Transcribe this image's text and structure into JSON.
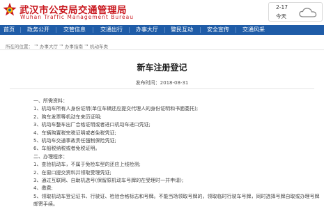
{
  "header": {
    "site_name": "武汉市公安局交通管理局",
    "site_name_en": "Wuhan Traffic Management Bureau",
    "brand_color": "#c8161d",
    "weather": {
      "date": "2-17",
      "today": "今天",
      "icon": "cloud-icon"
    }
  },
  "nav": {
    "background": "#1f5ca7",
    "items": [
      {
        "label": "首页"
      },
      {
        "label": "政务公开"
      },
      {
        "label": "交管信息"
      },
      {
        "label": "交通出行"
      },
      {
        "label": "办事大厅"
      },
      {
        "label": "警民互动"
      },
      {
        "label": "安全宣传"
      },
      {
        "label": "交通风采"
      }
    ]
  },
  "breadcrumb": {
    "prefix": "所在的位置：",
    "items": [
      "办事大厅",
      "办事指南",
      "机动车类"
    ],
    "separator": "→"
  },
  "article": {
    "title": "新车注册登记",
    "meta": "发布时间：2018-08-31",
    "lines": [
      "一、所需资料：",
      "1、机动车所有人身份证明(单位车辆还应提交代理人的身份证明和书面委托);",
      "2、购车发票等机动车来历证明;",
      "3、机动车整车出厂合格证明或者进口机动车进口凭证;",
      "4、车辆购置税完税证明或者免税凭证;",
      "5、机动车交通事故责任强制保险凭证;",
      "6、车船税纳税或者免税证明。",
      "二、办理程序：",
      "1、查验机动车，不属于免检车型的还应上线检测;",
      "2、在窗口提交资料并领取受理凭证;",
      "3、通过互联网、自助机选号(保留原机动车号牌的在受理时一并申请);",
      "4、缴费;",
      "5、领取机动车登记证书、行驶证、检验合格标志和号牌。不能当场领取号牌的，领取临时行驶车号牌，同时选择号牌自取或办理号牌邮寄手续。"
    ]
  }
}
